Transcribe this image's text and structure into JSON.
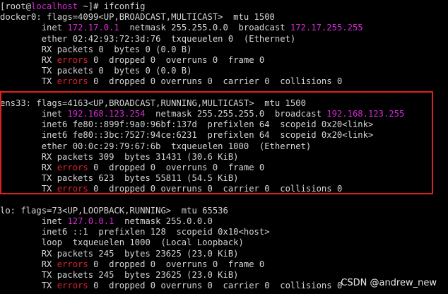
{
  "terminal": {
    "lines": [
      {
        "segs": [
          {
            "t": "[root@",
            "c": "text"
          },
          {
            "t": "localhost",
            "c": "host"
          },
          {
            "t": " ~]# ifconfig",
            "c": "text"
          }
        ]
      },
      {
        "segs": [
          {
            "t": "docker0: flags=4099<UP,BROADCAST,MULTICAST>  mtu 1500",
            "c": "text"
          }
        ]
      },
      {
        "segs": [
          {
            "t": "        inet ",
            "c": "text"
          },
          {
            "t": "172.17.0.1",
            "c": "ip"
          },
          {
            "t": "  netmask 255.255.0.0  broadcast ",
            "c": "text"
          },
          {
            "t": "172.17.255.255",
            "c": "ip"
          }
        ]
      },
      {
        "segs": [
          {
            "t": "        ether 02:42:93:72:3d:76  txqueuelen 0  (Ethernet)",
            "c": "text"
          }
        ]
      },
      {
        "segs": [
          {
            "t": "        RX packets 0  bytes 0 (0.0 B)",
            "c": "text"
          }
        ]
      },
      {
        "segs": [
          {
            "t": "        RX ",
            "c": "text"
          },
          {
            "t": "errors",
            "c": "err"
          },
          {
            "t": " 0  dropped 0  overruns 0  frame 0",
            "c": "text"
          }
        ]
      },
      {
        "segs": [
          {
            "t": "        TX packets 0  bytes 0 (0.0 B)",
            "c": "text"
          }
        ]
      },
      {
        "segs": [
          {
            "t": "        TX ",
            "c": "text"
          },
          {
            "t": "errors",
            "c": "err"
          },
          {
            "t": " 0  dropped 0 overruns 0  carrier 0  collisions 0",
            "c": "text"
          }
        ]
      },
      {
        "segs": [
          {
            "t": "",
            "c": "text"
          }
        ]
      },
      {
        "segs": [
          {
            "t": "ens33: flags=4163<UP,BROADCAST,RUNNING,MULTICAST>  mtu 1500",
            "c": "text"
          }
        ]
      },
      {
        "segs": [
          {
            "t": "        inet ",
            "c": "text"
          },
          {
            "t": "192.168.123.254",
            "c": "ip"
          },
          {
            "t": "  netmask 255.255.255.0  broadcast ",
            "c": "text"
          },
          {
            "t": "192.168.123.255",
            "c": "ip"
          }
        ]
      },
      {
        "segs": [
          {
            "t": "        inet6 fe80::899f:9a0:96bf:137d  prefixlen 64  scopeid 0x20<link>",
            "c": "text"
          }
        ]
      },
      {
        "segs": [
          {
            "t": "        inet6 fe80::3bc:7527:94ce:6231  prefixlen 64  scopeid 0x20<link>",
            "c": "text"
          }
        ]
      },
      {
        "segs": [
          {
            "t": "        ether 00:0c:29:79:67:6b  txqueuelen 1000  (Ethernet)",
            "c": "text"
          }
        ]
      },
      {
        "segs": [
          {
            "t": "        RX packets 309  bytes 31431 (30.6 KiB)",
            "c": "text"
          }
        ]
      },
      {
        "segs": [
          {
            "t": "        RX ",
            "c": "text"
          },
          {
            "t": "errors",
            "c": "err"
          },
          {
            "t": " 0  dropped 0  overruns 0  frame 0",
            "c": "text"
          }
        ]
      },
      {
        "segs": [
          {
            "t": "        TX packets 623  bytes 55811 (54.5 KiB)",
            "c": "text"
          }
        ]
      },
      {
        "segs": [
          {
            "t": "        TX ",
            "c": "text"
          },
          {
            "t": "errors",
            "c": "err"
          },
          {
            "t": " 0  dropped 0 overruns 0  carrier 0  collisions 0",
            "c": "text"
          }
        ]
      },
      {
        "segs": [
          {
            "t": "",
            "c": "text"
          }
        ]
      },
      {
        "segs": [
          {
            "t": "lo: flags=73<UP,LOOPBACK,RUNNING>  mtu 65536",
            "c": "text"
          }
        ]
      },
      {
        "segs": [
          {
            "t": "        inet ",
            "c": "text"
          },
          {
            "t": "127.0.0.1",
            "c": "ip"
          },
          {
            "t": "  netmask 255.0.0.0",
            "c": "text"
          }
        ]
      },
      {
        "segs": [
          {
            "t": "        inet6 ::1  prefixlen 128  scopeid 0x10<host>",
            "c": "text"
          }
        ]
      },
      {
        "segs": [
          {
            "t": "        loop  txqueuelen 1000  (Local Loopback)",
            "c": "text"
          }
        ]
      },
      {
        "segs": [
          {
            "t": "        RX packets 245  bytes 23625 (23.0 KiB)",
            "c": "text"
          }
        ]
      },
      {
        "segs": [
          {
            "t": "        RX ",
            "c": "text"
          },
          {
            "t": "errors",
            "c": "err"
          },
          {
            "t": " 0  dropped 0  overruns 0  frame 0",
            "c": "text"
          }
        ]
      },
      {
        "segs": [
          {
            "t": "        TX packets 245  bytes 23625 (23.0 KiB)",
            "c": "text"
          }
        ]
      },
      {
        "segs": [
          {
            "t": "        TX ",
            "c": "text"
          },
          {
            "t": "errors",
            "c": "err"
          },
          {
            "t": " 0  dropped 0 overruns 0  carrier 0  collisions 0",
            "c": "text"
          }
        ]
      }
    ]
  },
  "watermark": "CSDN @andrew_new",
  "colors": {
    "background": "#000000",
    "text": "#d6d6d6",
    "ip": "#d62ad6",
    "errors": "#d8232a",
    "highlight_box": "#e0201e"
  }
}
